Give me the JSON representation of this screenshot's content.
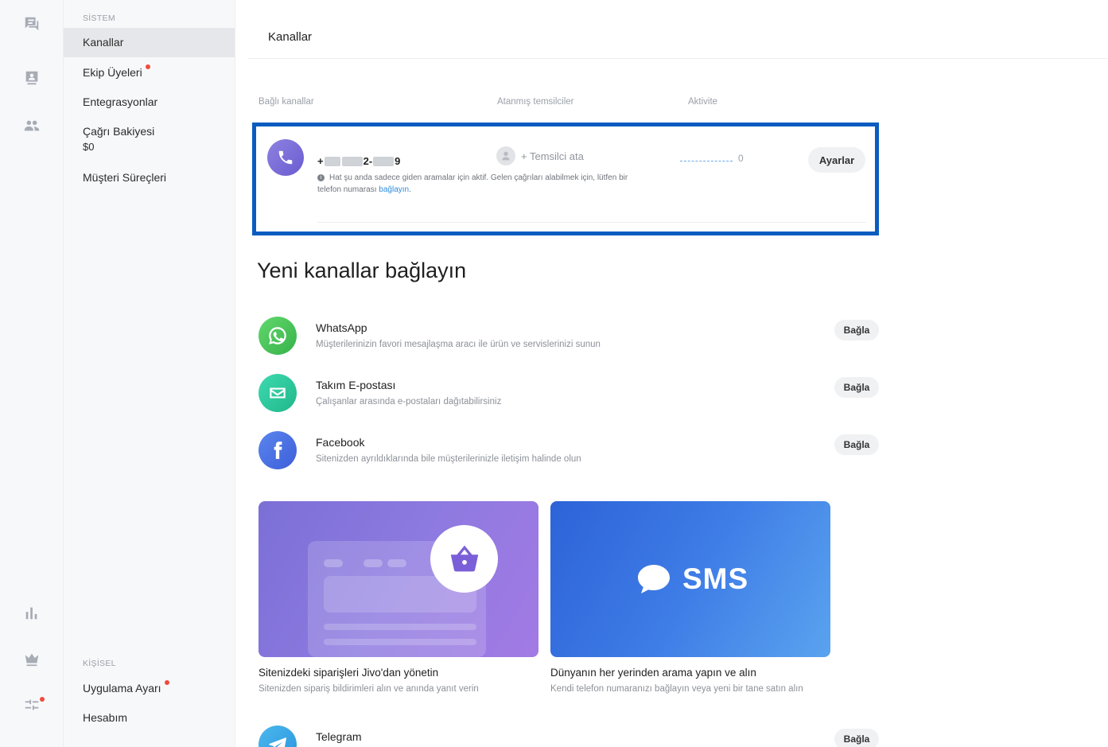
{
  "rail": {
    "icons": [
      "chat-icon",
      "contacts-card-icon",
      "team-icon",
      "reports-icon",
      "crown-icon",
      "settings-sliders-icon"
    ]
  },
  "sidebar": {
    "system_label": "SİSTEM",
    "items": [
      {
        "label": "Kanallar"
      },
      {
        "label": "Ekip Üyeleri"
      },
      {
        "label": "Entegrasyonlar"
      },
      {
        "label": "Çağrı Bakiyesi",
        "sub": "$0"
      },
      {
        "label": "Müşteri Süreçleri"
      }
    ],
    "personal_label": "KİŞİSEL",
    "personal_items": [
      {
        "label": "Uygulama Ayarı"
      },
      {
        "label": "Hesabım"
      }
    ]
  },
  "header": {
    "title": "Kanallar"
  },
  "table": {
    "columns": [
      "Bağlı kanallar",
      "Atanmış temsilciler",
      "Aktivite"
    ]
  },
  "channel": {
    "phone_prefix": "+",
    "phone_mid": "2-",
    "phone_end": "9",
    "note": "Hat şu anda sadece giden aramalar için aktif. Gelen çağrıları alabilmek için, lütfen bir telefon numarası",
    "note_link": "bağlayın",
    "note_end": ".",
    "assign_label": "+ Temsilci ata",
    "activity_count": "0",
    "settings_label": "Ayarlar"
  },
  "new_channels": {
    "title": "Yeni kanallar bağlayın",
    "connect_label": "Bağla",
    "items": [
      {
        "name": "WhatsApp",
        "desc": "Müşterilerinizin favori mesajlaşma aracı ile ürün ve servislerinizi sunun",
        "color": "#4cc75a"
      },
      {
        "name": "Takım E-postası",
        "desc": "Çalışanlar arasında e-postaları dağıtabilirsiniz",
        "color": "#2ecc9a"
      },
      {
        "name": "Facebook",
        "desc": "Sitenizden ayrıldıklarında bile müşterilerinizle iletişim halinde olun",
        "color": "#4d6fe0"
      },
      {
        "name": "Telegram",
        "color": "#35a4e6"
      }
    ]
  },
  "promos": [
    {
      "title": "Sitenizdeki siparişleri Jivo'dan yönetin",
      "desc": "Sitenizden sipariş bildirimleri alın ve anında yanıt verin"
    },
    {
      "title": "Dünyanın her yerinden arama yapın ve alın",
      "desc": "Kendi telefon numaranızı bağlayın veya yeni bir tane satın alın",
      "banner_text": "SMS"
    }
  ]
}
